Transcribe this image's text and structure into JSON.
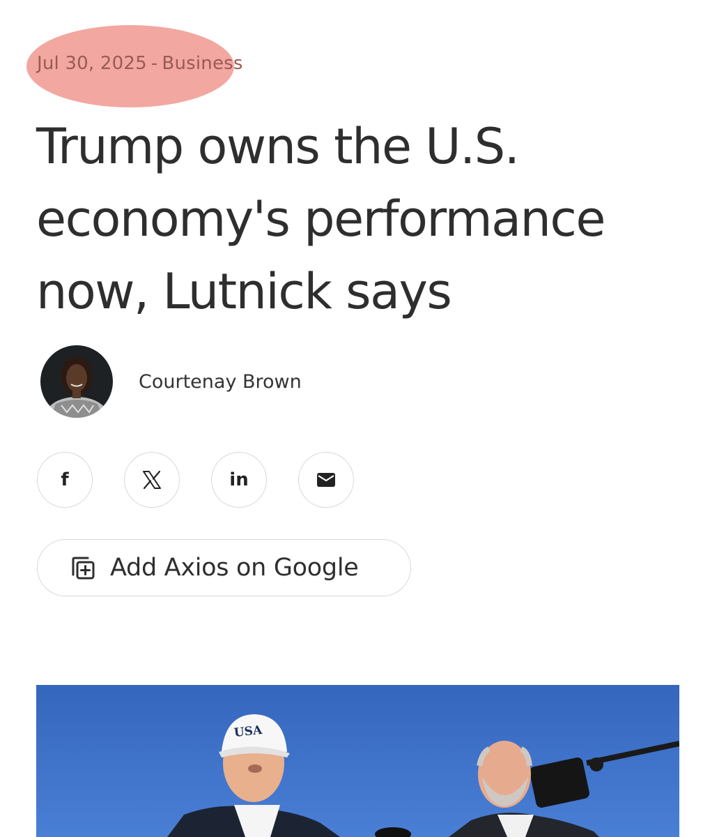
{
  "article": {
    "date": "Jul 30, 2025",
    "separator": "-",
    "category": "Business",
    "headline": "Trump owns the U.S. economy's performance now, Lutnick says",
    "author": {
      "name": "Courtenay Brown",
      "avatar_icon": "author-portrait"
    }
  },
  "share": {
    "buttons": [
      {
        "name": "facebook",
        "glyph": "f",
        "icon": "facebook-icon"
      },
      {
        "name": "x",
        "icon": "x-icon"
      },
      {
        "name": "linkedin",
        "glyph": "in",
        "icon": "linkedin-icon"
      },
      {
        "name": "email",
        "icon": "mail-icon"
      }
    ]
  },
  "google_button": {
    "label": "Add Axios on Google",
    "icon": "add-source-icon"
  },
  "hero_image": {
    "cap_text": "USA"
  },
  "colors": {
    "highlight": "#f2a7a0",
    "dateline": "#9a5a55",
    "sky": "#3d6fc4"
  }
}
